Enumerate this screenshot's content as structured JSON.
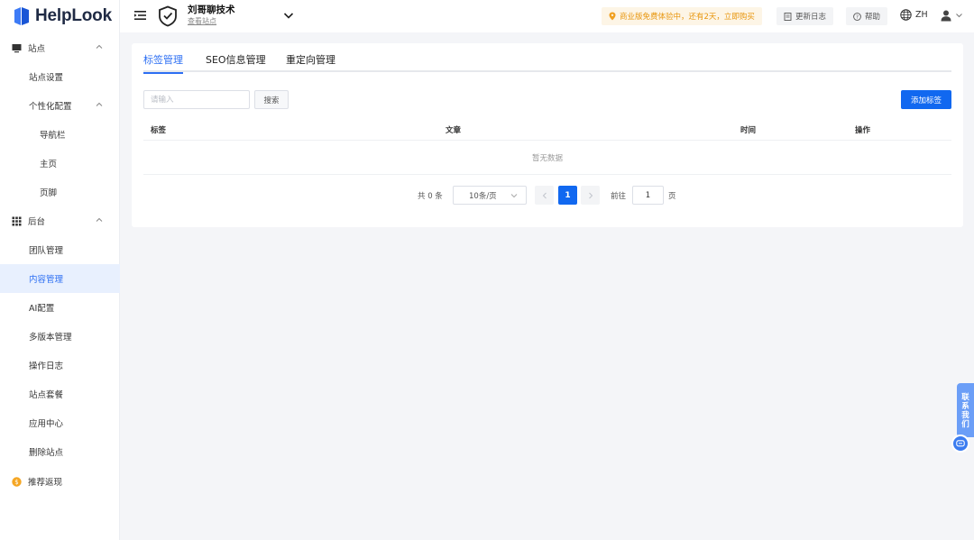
{
  "brand": {
    "name": "HelpLook"
  },
  "sidebar": {
    "site_group": "站点",
    "site_settings": "站点设置",
    "personalize": "个性化配置",
    "personalize_items": [
      "导航栏",
      "主页",
      "页脚"
    ],
    "backend_group": "后台",
    "backend_items": [
      "团队管理",
      "内容管理",
      "AI配置",
      "多版本管理",
      "操作日志",
      "站点套餐",
      "应用中心",
      "删除站点"
    ],
    "active_item": "内容管理",
    "referral": "推荐返现"
  },
  "topbar": {
    "site_name": "刘哥聊技术",
    "view_site": "查看站点",
    "promo": "商业版免费体验中，还有2天，立即购买",
    "changelog": "更新日志",
    "help": "帮助",
    "language": "ZH"
  },
  "tabs": [
    "标签管理",
    "SEO信息管理",
    "重定向管理"
  ],
  "active_tab": "标签管理",
  "toolbar": {
    "search_placeholder": "请输入",
    "search_label": "搜索",
    "add_label": "添加标签"
  },
  "table": {
    "columns": [
      "标签",
      "文章",
      "时间",
      "操作"
    ],
    "empty_text": "暂无数据"
  },
  "pagination": {
    "total": "共 0 条",
    "page_size": "10条/页",
    "current_page": "1",
    "goto_label": "前往",
    "goto_value": "1",
    "goto_unit": "页"
  },
  "floating": {
    "contact": [
      "联",
      "系",
      "我",
      "们"
    ]
  },
  "colors": {
    "accent": "#1168f0",
    "active_bg": "#e8f0fe",
    "promo_text": "#e8960e",
    "promo_bg": "#fdf5e6"
  }
}
